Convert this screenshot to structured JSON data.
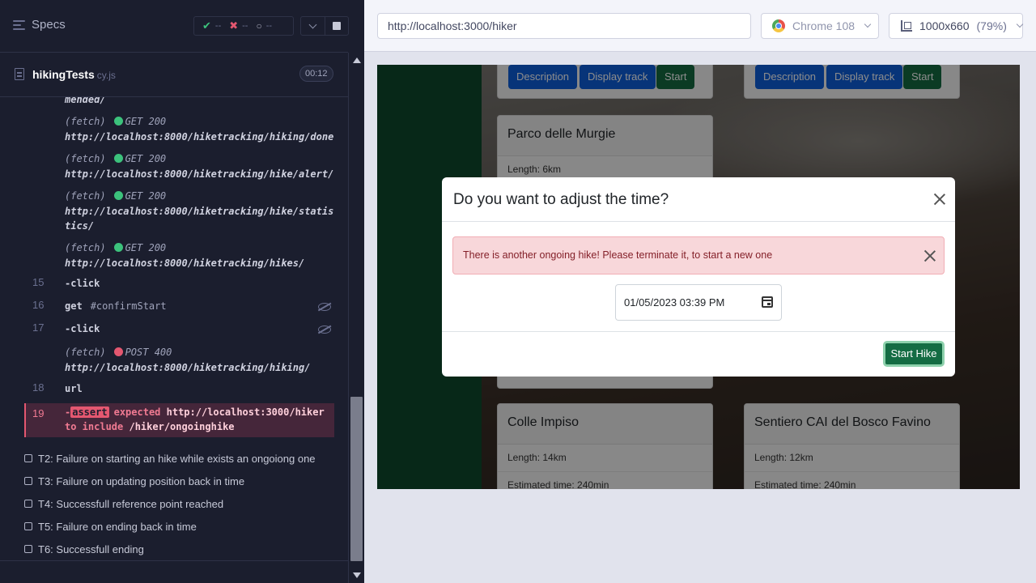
{
  "reporter": {
    "specs_label": "Specs",
    "stats": {
      "passed": "--",
      "failed": "--",
      "pending": "--"
    },
    "spec_name": "hikingTests",
    "spec_ext": "cy.js",
    "duration": "00:12"
  },
  "log": {
    "truncated_tail": "mended/",
    "fetch_label": "(fetch)",
    "entries": [
      {
        "method": "GET 200",
        "url": "http://localhost:8000/hiketracking/hiking/done"
      },
      {
        "method": "GET 200",
        "url": "http://localhost:8000/hiketracking/hike/alert/"
      },
      {
        "method": "GET 200",
        "url": "http://localhost:8000/hiketracking/hike/statis",
        "url2": "tics/"
      },
      {
        "method": "GET 200",
        "url": "http://localhost:8000/hiketracking/hikes/"
      }
    ],
    "cmd15": {
      "num": "15",
      "text": "-click"
    },
    "cmd16": {
      "num": "16",
      "text": "get",
      "selector": "#confirmStart"
    },
    "cmd17": {
      "num": "17",
      "text": "-click"
    },
    "post": {
      "method": "POST 400",
      "url": "http://localhost:8000/hiketracking/hiking/"
    },
    "cmd18": {
      "num": "18",
      "text": "url"
    },
    "failed": {
      "num": "19",
      "prefix": "-",
      "badge": "assert",
      "expected": "expected",
      "actual_url": "http://localhost:3000/hiker",
      "to_include": "to include",
      "target": "/hiker/ongoinghike"
    }
  },
  "tests": [
    "T2: Failure on starting an hike while exists an ongoiong one",
    "T3: Failure on updating position back in time",
    "T4: Successfull reference point reached",
    "T5: Failure on ending back in time",
    "T6: Successfull ending"
  ],
  "aut": {
    "url": "http://localhost:3000/hiker",
    "browser": "Chrome 108",
    "viewport": "1000x660",
    "zoom": "(79%)"
  },
  "app": {
    "top_buttons": {
      "description": "Description",
      "display_track": "Display track",
      "start": "Start"
    },
    "card_parco": {
      "title": "Parco delle Murgie",
      "length": "Length: 6km"
    },
    "card_colle": {
      "title": "Colle Impiso",
      "length": "Length: 14km",
      "time": "Estimated time: 240min"
    },
    "card_sentiero": {
      "title": "Sentiero CAI del Bosco Favino",
      "length": "Length: 12km",
      "time": "Estimated time: 240min"
    },
    "modal": {
      "title": "Do you want to adjust the time?",
      "alert": "There is another ongoing hike! Please terminate it, to start a new one",
      "datetime": "01/05/2023 03:39 PM",
      "start_button": "Start Hike"
    }
  },
  "colors": {
    "sidebar_green": "#0d4a2d",
    "primary_blue": "#0d5fdd",
    "success_green": "#146c43",
    "fail_red": "#e45770",
    "pass_green": "#3cc27c"
  }
}
